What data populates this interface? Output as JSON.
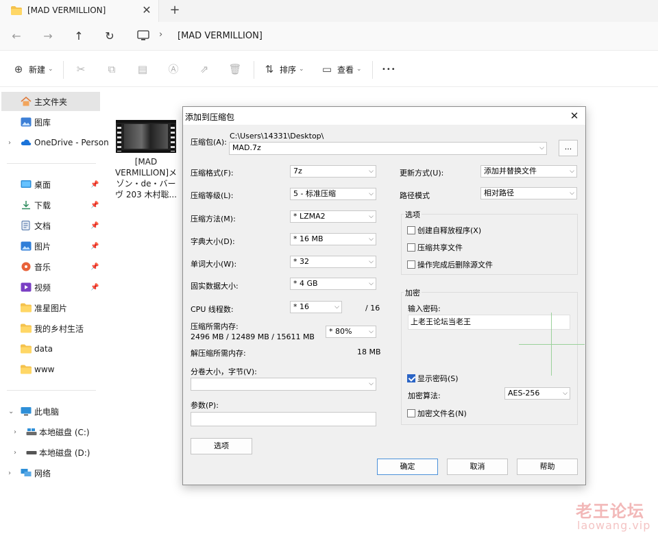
{
  "tabbar": {
    "tab_title": "[MAD VERMILLION]",
    "close_glyph": "✕",
    "add_glyph": "+"
  },
  "navbar": {
    "back_glyph": "←",
    "forward_glyph": "→",
    "up_glyph": "↑",
    "refresh_glyph": "↻",
    "crumb_sep": "›",
    "crumb": "[MAD VERMILLION]"
  },
  "cmdbar": {
    "new_label": "新建",
    "sort_label": "排序",
    "view_label": "查看",
    "more_glyph": "•••"
  },
  "sidebar": {
    "home": "主文件夹",
    "gallery": "图库",
    "onedrive": "OneDrive - Person",
    "desktop": "桌面",
    "downloads": "下载",
    "documents": "文档",
    "pictures": "图片",
    "music": "音乐",
    "videos": "视频",
    "folder1": "准星图片",
    "folder2": "我的乡村生活",
    "folder3": "data",
    "folder4": "www",
    "thispc": "此电脑",
    "drive_c": "本地磁盘 (C:)",
    "drive_d": "本地磁盘 (D:)",
    "network": "网络"
  },
  "file": {
    "name_line1": "[MAD",
    "name_line2": "VERMILLION]メ",
    "name_line3": "ゾン・de・バー",
    "name_line4": "ヴ 203 木村聡..."
  },
  "dialog": {
    "title": "添加到压缩包",
    "archive_label": "压缩包(A):",
    "archive_path": "C:\\Users\\14331\\Desktop\\",
    "archive_name": "MAD.7z",
    "browse_label": "...",
    "format_label": "压缩格式(F):",
    "format_value": "7z",
    "level_label": "压缩等级(L):",
    "level_value": "5 - 标准压缩",
    "method_label": "压缩方法(M):",
    "method_value": "* LZMA2",
    "dict_label": "字典大小(D):",
    "dict_value": "* 16 MB",
    "word_label": "单词大小(W):",
    "word_value": "* 32",
    "solid_label": "固实数据大小:",
    "solid_value": "* 4 GB",
    "cpu_label": "CPU 线程数:",
    "cpu_value": "* 16",
    "cpu_total": "/ 16",
    "mem_label": "压缩所需内存:",
    "mem_values": "2496 MB / 12489 MB / 15611 MB",
    "mem_percent": "* 80%",
    "decomp_label": "解压缩所需内存:",
    "decomp_value": "18 MB",
    "split_label": "分卷大小，字节(V):",
    "params_label": "参数(P):",
    "options_button": "选项",
    "update_label": "更新方式(U):",
    "update_value": "添加并替换文件",
    "path_label": "路径模式",
    "path_value": "相对路径",
    "options_group": "选项",
    "opt_sfx": "创建自释放程序(X)",
    "opt_shared": "压缩共享文件",
    "opt_delete": "操作完成后删除源文件",
    "encrypt_group": "加密",
    "password_label": "输入密码:",
    "password_value": "上老王论坛当老王",
    "show_password": "显示密码(S)",
    "enc_method_label": "加密算法:",
    "enc_method_value": "AES-256",
    "encrypt_names": "加密文件名(N)",
    "ok_button": "确定",
    "cancel_button": "取消",
    "help_button": "帮助",
    "dropdown_glyph": "⌵"
  },
  "watermark": {
    "line1": "老王论坛",
    "line2": "laowang.vip"
  }
}
